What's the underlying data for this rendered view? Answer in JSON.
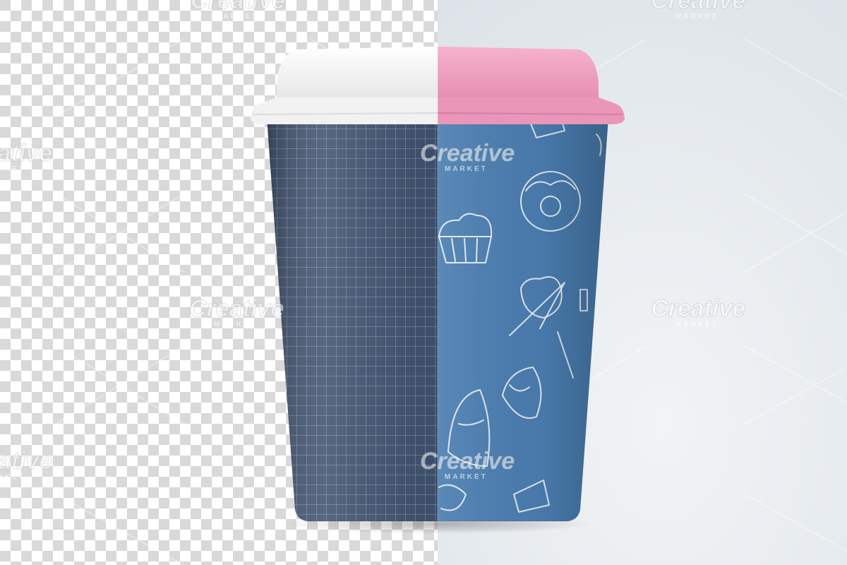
{
  "colors": {
    "checker_light": "#ffffff",
    "checker_dark": "#d9d9d9",
    "backdrop": "#e4e9ed",
    "cup_left": "#3f5270",
    "cup_right": "#4b7fb3",
    "lid_left": "#f7f7f7",
    "lid_right": "#f0a0c0"
  },
  "watermark": {
    "brand": "Creative",
    "sub": "MARKET"
  }
}
